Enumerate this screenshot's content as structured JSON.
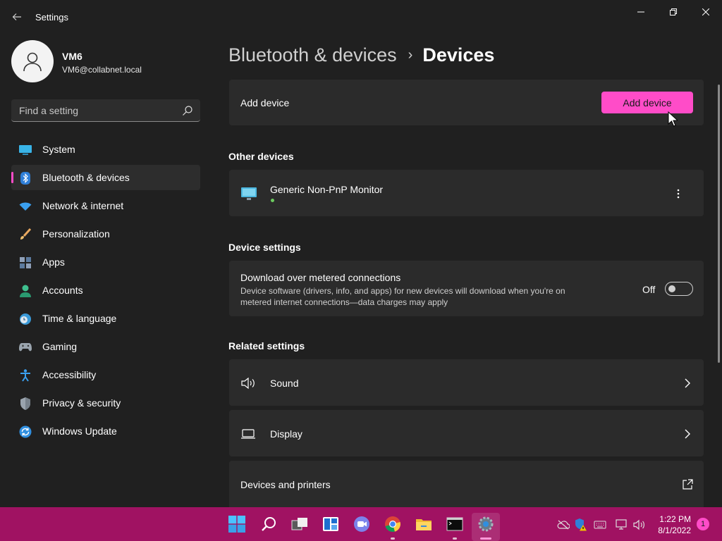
{
  "window": {
    "title": "Settings"
  },
  "profile": {
    "name": "VM6",
    "email": "VM6@collabnet.local"
  },
  "search": {
    "placeholder": "Find a setting"
  },
  "sidebar": {
    "items": [
      {
        "label": "System",
        "icon": "system-icon"
      },
      {
        "label": "Bluetooth & devices",
        "icon": "bluetooth-icon",
        "active": true
      },
      {
        "label": "Network & internet",
        "icon": "wifi-icon"
      },
      {
        "label": "Personalization",
        "icon": "brush-icon"
      },
      {
        "label": "Apps",
        "icon": "apps-icon"
      },
      {
        "label": "Accounts",
        "icon": "accounts-icon"
      },
      {
        "label": "Time & language",
        "icon": "clock-globe-icon"
      },
      {
        "label": "Gaming",
        "icon": "gamepad-icon"
      },
      {
        "label": "Accessibility",
        "icon": "accessibility-icon"
      },
      {
        "label": "Privacy & security",
        "icon": "shield-icon"
      },
      {
        "label": "Windows Update",
        "icon": "update-icon"
      }
    ]
  },
  "breadcrumb": {
    "parent": "Bluetooth & devices",
    "separator": "›",
    "current": "Devices"
  },
  "add_device": {
    "label": "Add device",
    "button_label": "Add device"
  },
  "other_devices": {
    "header": "Other devices",
    "devices": [
      {
        "name": "Generic Non-PnP Monitor",
        "icon": "monitor-icon",
        "status_color": "#6ccb5f"
      }
    ]
  },
  "device_settings": {
    "header": "Device settings",
    "metered": {
      "title": "Download over metered connections",
      "description": "Device software (drivers, info, and apps) for new devices will download when you're on metered internet connections—data charges may apply",
      "toggle_label": "Off",
      "toggle_on": false
    }
  },
  "related_settings": {
    "header": "Related settings",
    "items": [
      {
        "label": "Sound",
        "icon": "speaker-icon",
        "action": "chevron"
      },
      {
        "label": "Display",
        "icon": "laptop-icon",
        "action": "chevron"
      },
      {
        "label": "Devices and printers",
        "icon": "",
        "action": "external"
      }
    ]
  },
  "taskbar": {
    "apps": [
      "start-icon",
      "search-icon",
      "task-view-icon",
      "widgets-icon",
      "chat-icon",
      "chrome-icon",
      "file-explorer-icon",
      "terminal-icon",
      "settings-icon"
    ],
    "clock_time": "1:22 PM",
    "clock_date": "8/1/2022",
    "notification_count": "1"
  },
  "colors": {
    "accent": "#ff4cc8",
    "taskbar": "#a01262",
    "background": "#202020",
    "card": "#2b2b2b"
  }
}
